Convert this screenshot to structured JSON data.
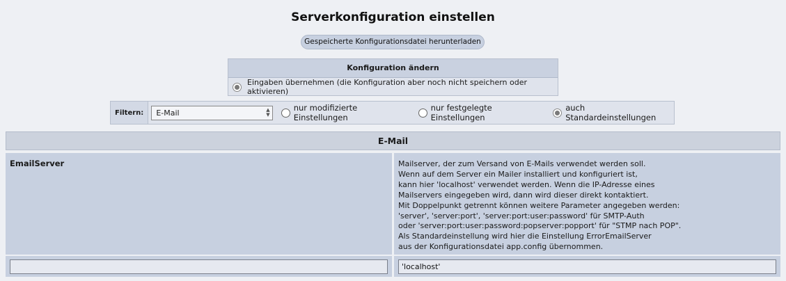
{
  "page": {
    "title": "Serverkonfiguration einstellen",
    "download_button": "Gespeicherte Konfigurationsdatei herunterladen"
  },
  "config_panel": {
    "header": "Konfiguration ändern",
    "apply_option": "Eingaben übernehmen (die Konfiguration aber noch nicht speichern oder aktivieren)"
  },
  "filter": {
    "label": "Filtern:",
    "selected_category": "E-Mail",
    "options": [
      {
        "label": "nur modifizierte Einstellungen",
        "checked": false
      },
      {
        "label": "nur festgelegte Einstellungen",
        "checked": false
      },
      {
        "label": "auch Standardeinstellungen",
        "checked": true
      }
    ]
  },
  "section": {
    "title": "E-Mail"
  },
  "setting": {
    "name": "EmailServer",
    "description_lines": [
      "Mailserver, der zum Versand von E-Mails verwendet werden soll.",
      "Wenn auf dem Server ein Mailer installiert und konfiguriert ist,",
      "kann hier 'localhost' verwendet werden. Wenn die IP-Adresse eines",
      "Mailservers eingegeben wird, dann wird dieser direkt kontaktiert.",
      "Mit Doppelpunkt getrennt können weitere Parameter angegeben werden:",
      "'server', 'server:port', 'server:port:user:password' für SMTP-Auth",
      "oder 'server:port:user:password:popserver:popport' für \"STMP nach POP\".",
      "Als Standardeinstellung wird hier die Einstellung ErrorEmailServer",
      "aus der Konfigurationsdatei app.config übernommen."
    ],
    "value": "",
    "default_value": "'localhost'"
  }
}
